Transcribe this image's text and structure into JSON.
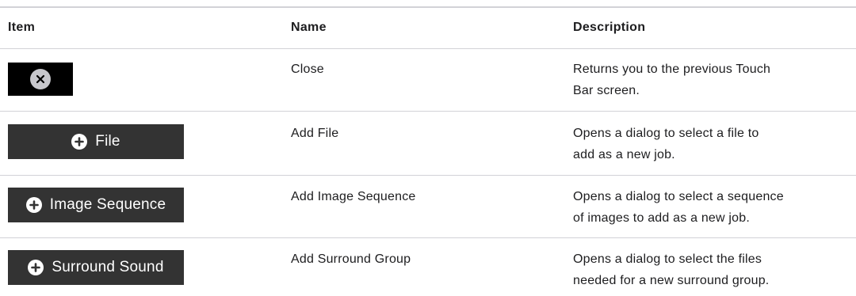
{
  "headers": {
    "item": "Item",
    "name": "Name",
    "description": "Description"
  },
  "rows": [
    {
      "button_label": "",
      "button_icon": "close-icon",
      "name": "Close",
      "description_lines": [
        "Returns you to the previous Touch",
        "Bar screen."
      ]
    },
    {
      "button_label": "File",
      "button_icon": "add-icon",
      "name": "Add File",
      "description_lines": [
        "Opens a dialog to select a file to",
        "add as a new job."
      ]
    },
    {
      "button_label": "Image Sequence",
      "button_icon": "add-icon",
      "name": "Add Image Sequence",
      "description_lines": [
        "Opens a dialog to select a sequence",
        "of images to add as a new job."
      ]
    },
    {
      "button_label": "Surround Sound",
      "button_icon": "add-icon",
      "name": "Add Surround Group",
      "description_lines": [
        "Opens a dialog to select the files",
        "needed for a new surround group."
      ]
    }
  ]
}
